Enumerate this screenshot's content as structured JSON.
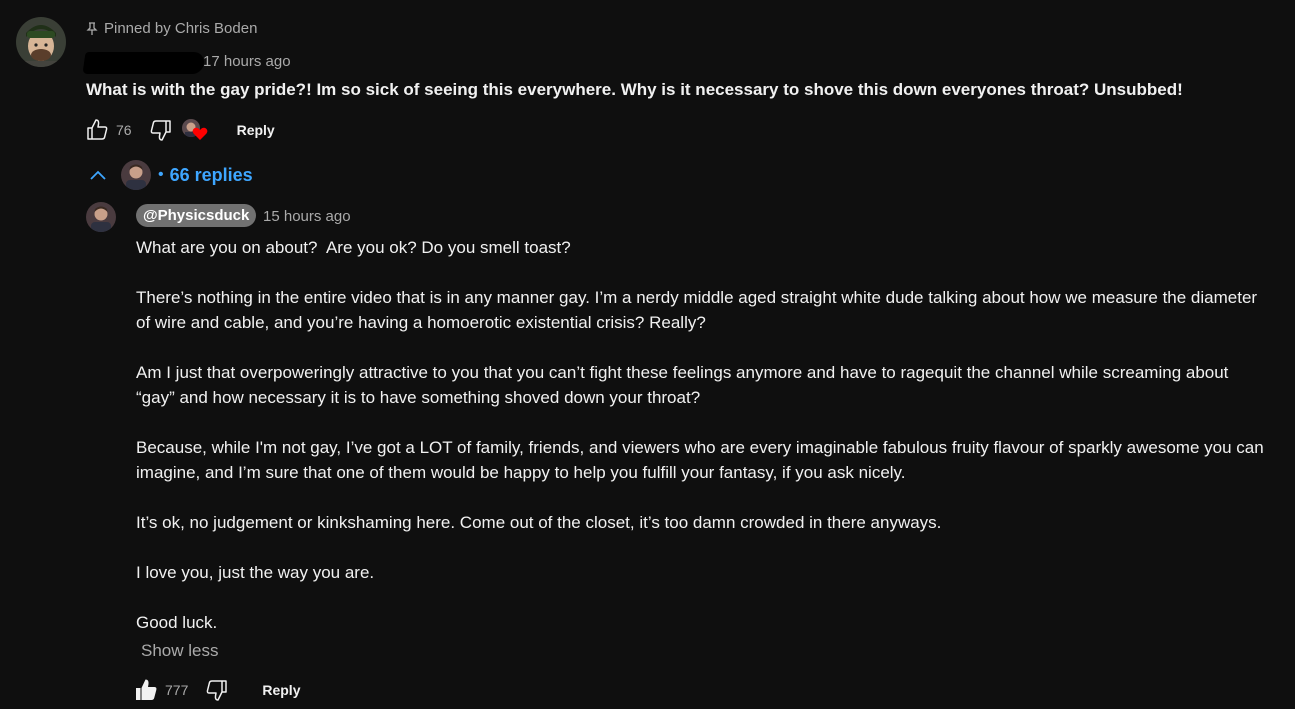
{
  "comment": {
    "pinned_label": "Pinned by Chris Boden",
    "timestamp": "17 hours ago",
    "text": "What is with the gay pride?! Im so sick of seeing this everywhere. Why is it necessary to shove this down everyones throat? Unsubbed!",
    "like_count": "76",
    "reply_label": "Reply",
    "icons": [
      "pin-icon",
      "thumbs-up-icon",
      "thumbs-down-icon",
      "creator-heart-icon"
    ]
  },
  "replies_toggle": {
    "label": "66 replies",
    "separator": "•",
    "color": "#3ea6ff"
  },
  "reply": {
    "author": "@Physicsduck",
    "timestamp": "15 hours ago",
    "paragraphs": [
      "What are you on about?  Are you ok? Do you smell toast?",
      "There’s nothing in the entire video that is in any manner gay. I’m a nerdy middle aged straight white dude talking about how we measure the diameter of wire and cable, and you’re having a homoerotic existential crisis? Really?",
      "Am I just that overpoweringly attractive to you that you can’t fight these feelings anymore and have to ragequit the channel while screaming about “gay” and how necessary it is to have something shoved down your throat?",
      "Because, while I'm not gay, I’ve got a LOT of family, friends, and viewers who are every imaginable fabulous fruity flavour of sparkly awesome you can imagine, and I’m sure that one of them would be happy to help you fulfill your fantasy, if you ask nicely.",
      "It’s ok, no judgement or kinkshaming here. Come out of the closet, it’s too damn crowded in there anyways.",
      "I love you, just the way you are.",
      "Good luck."
    ],
    "show_less_label": "Show less",
    "like_count": "777",
    "liked": true,
    "reply_label": "Reply"
  },
  "colors": {
    "background": "#0f0f0f",
    "text": "#f1f1f1",
    "secondary_text": "#aaaaaa",
    "link": "#3ea6ff",
    "author_badge": "#717171",
    "heart": "#ff0000"
  }
}
